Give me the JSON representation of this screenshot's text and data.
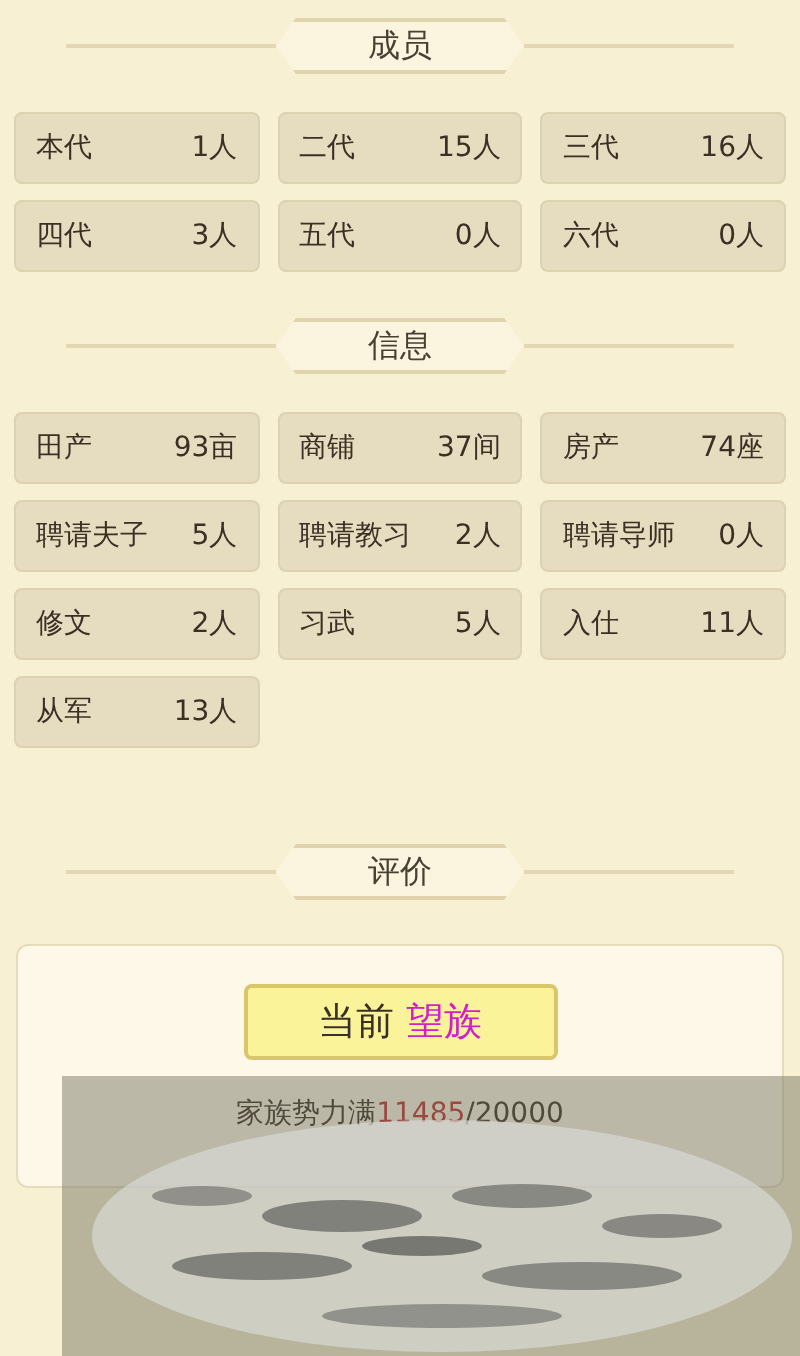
{
  "sections": [
    {
      "title": "成员",
      "items": [
        {
          "label": "本代",
          "value": "1人"
        },
        {
          "label": "二代",
          "value": "15人"
        },
        {
          "label": "三代",
          "value": "16人"
        },
        {
          "label": "四代",
          "value": "3人"
        },
        {
          "label": "五代",
          "value": "0人"
        },
        {
          "label": "六代",
          "value": "0人"
        }
      ]
    },
    {
      "title": "信息",
      "items": [
        {
          "label": "田产",
          "value": "93亩"
        },
        {
          "label": "商铺",
          "value": "37间"
        },
        {
          "label": "房产",
          "value": "74座"
        },
        {
          "label": "聘请夫子",
          "value": "5人"
        },
        {
          "label": "聘请教习",
          "value": "2人"
        },
        {
          "label": "聘请导师",
          "value": "0人"
        },
        {
          "label": "修文",
          "value": "2人"
        },
        {
          "label": "习武",
          "value": "5人"
        },
        {
          "label": "入仕",
          "value": "11人"
        },
        {
          "label": "从军",
          "value": "13人"
        }
      ]
    }
  ],
  "rating": {
    "title": "评价",
    "current_label": "当前",
    "current_rank": "望族",
    "progress_label": "家族势力满",
    "progress_current": "11485",
    "progress_max": "/20000"
  }
}
